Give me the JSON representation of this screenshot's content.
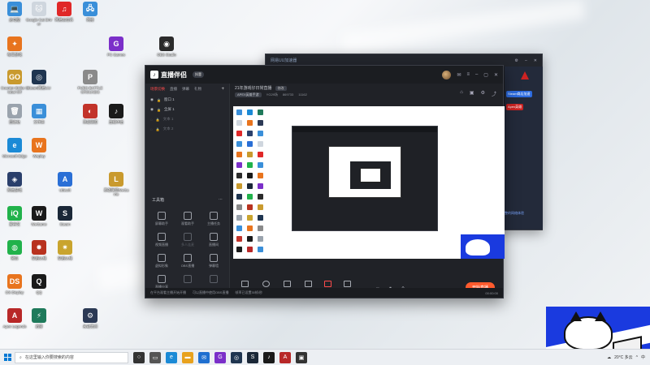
{
  "desktop": {
    "icons": [
      {
        "label": "此电脑",
        "color": "#3a8fd9",
        "glyph": "💻"
      },
      {
        "label": "Google Cat Driver",
        "color": "#cfd6de",
        "glyph": "🐱"
      },
      {
        "label": "网易云音乐",
        "color": "#e02828",
        "glyph": "♫"
      },
      {
        "label": "网络",
        "color": "#3a8fd9",
        "glyph": "🖧"
      },
      {
        "label": "每日游戏",
        "color": "#e8741e",
        "glyph": "✦"
      },
      {
        "label": "PC Games",
        "color": "#7b2fc9",
        "glyph": "G"
      },
      {
        "label": "OBS Studio",
        "color": "#2b2b2b",
        "glyph": "◉"
      },
      {
        "label": "Counter-Strike Global Off",
        "color": "#c99a2e",
        "glyph": "GO"
      },
      {
        "label": "Steam网易UU",
        "color": "#1f3550",
        "glyph": "◎"
      },
      {
        "label": "PUBG BATTLEGROUNDS",
        "color": "#8a8a8a",
        "glyph": "P"
      },
      {
        "label": "回收站",
        "color": "#9aa3ad",
        "glyph": "🗑"
      },
      {
        "label": "文件夹",
        "color": "#3a8fd9",
        "glyph": "▦"
      },
      {
        "label": "英雄联盟",
        "color": "#c2332a",
        "glyph": "◐"
      },
      {
        "label": "直播伴侣",
        "color": "#1a1a1a",
        "glyph": "♪"
      },
      {
        "label": "Microsoft Edge",
        "color": "#1b8ad6",
        "glyph": "e"
      },
      {
        "label": "Weplay",
        "color": "#e8741e",
        "glyph": "W"
      },
      {
        "label": "网易游戏",
        "color": "#2a3f6b",
        "glyph": "◈"
      },
      {
        "label": "Ubisoft",
        "color": "#2a6fd6",
        "glyph": "A"
      },
      {
        "label": "英雄联盟WeGame",
        "color": "#c99a2e",
        "glyph": "L"
      },
      {
        "label": "爱奇艺",
        "color": "#21b24b",
        "glyph": "iQ"
      },
      {
        "label": "WeGame",
        "color": "#1a1a1a",
        "glyph": "W"
      },
      {
        "label": "Steam",
        "color": "#1b2838",
        "glyph": "S"
      },
      {
        "label": "微信",
        "color": "#21b24b",
        "glyph": "◍"
      },
      {
        "label": "穿越火线",
        "color": "#b8321f",
        "glyph": "✸"
      },
      {
        "label": "穿越火线",
        "color": "#c9a42e",
        "glyph": "✷"
      },
      {
        "label": "DS Display",
        "color": "#e8741e",
        "glyph": "DS"
      },
      {
        "label": "QQ",
        "color": "#1a1a1a",
        "glyph": "Q"
      },
      {
        "label": "Apex Legends",
        "color": "#b82828",
        "glyph": "A"
      },
      {
        "label": "迅雷",
        "color": "#1f7a5b",
        "glyph": "⚡"
      },
      {
        "label": "永劫无间",
        "color": "#2c3a55",
        "glyph": "⚙"
      }
    ]
  },
  "back_window": {
    "title": "网易UU加速器",
    "side_tags": [
      "Apex英雄",
      "Steam商店加速"
    ],
    "side_text": "完整的网络体验"
  },
  "main_window": {
    "brand": "直播伴侣",
    "brand_badge": "抖音",
    "left_tabs": [
      "场景切换",
      "直播",
      "弹幕",
      "礼物"
    ],
    "scenes": [
      {
        "label": "窗口 1",
        "dim": false
      },
      {
        "label": "全屏 1",
        "dim": false
      },
      {
        "label": "文本 1",
        "dim": true
      },
      {
        "label": "文本 2",
        "dim": true
      }
    ],
    "tools_title": "工具箱",
    "tools": [
      {
        "label": "屏幕助手",
        "dim": false
      },
      {
        "label": "观看助手",
        "dim": false
      },
      {
        "label": "主播任务",
        "dim": false
      },
      {
        "label": "视频直播",
        "dim": false
      },
      {
        "label": "多人连麦",
        "dim": true
      },
      {
        "label": "直播间",
        "dim": false
      },
      {
        "label": "虚拟形象",
        "dim": false
      },
      {
        "label": "OBS直播",
        "dim": false
      },
      {
        "label": "弹幕墙",
        "dim": false
      },
      {
        "label": "直播分享",
        "dim": false
      },
      {
        "label": "",
        "dim": true
      },
      {
        "label": "",
        "dim": true
      }
    ],
    "room_title": "21年游戏仔日常直播",
    "room_tag": "修改",
    "game": "APEX英雄手游",
    "stat1": "YG29场",
    "stat2": "869733",
    "stat3": "11162",
    "bottom_buttons": [
      "直播屏幕",
      "摄像头",
      "手机投屏",
      "多媒体",
      "麦克风",
      "扬声器"
    ],
    "start_label": "开始直播",
    "status_tip": "在平台观看主播开始开播",
    "status_mid": "可以直播中使用OBS直播",
    "status_right": "帧率已设置30帧/秒",
    "time": "00:00:00"
  },
  "taskbar": {
    "search_placeholder": "在这里输入你要搜索的内容",
    "apps": [
      {
        "glyph": "○",
        "color": "#333"
      },
      {
        "glyph": "▭",
        "color": "#555"
      },
      {
        "glyph": "e",
        "color": "#1b8ad6"
      },
      {
        "glyph": "▬",
        "color": "#e8a21e"
      },
      {
        "glyph": "✉",
        "color": "#1f6fd0"
      },
      {
        "glyph": "G",
        "color": "#7b2fc9"
      },
      {
        "glyph": "◎",
        "color": "#1f3550"
      },
      {
        "glyph": "S",
        "color": "#1b2838"
      },
      {
        "glyph": "♪",
        "color": "#1a1a1a"
      },
      {
        "glyph": "A",
        "color": "#b82828"
      },
      {
        "glyph": "▣",
        "color": "#333"
      }
    ],
    "weather": "20°C 多云",
    "lang": "中"
  }
}
